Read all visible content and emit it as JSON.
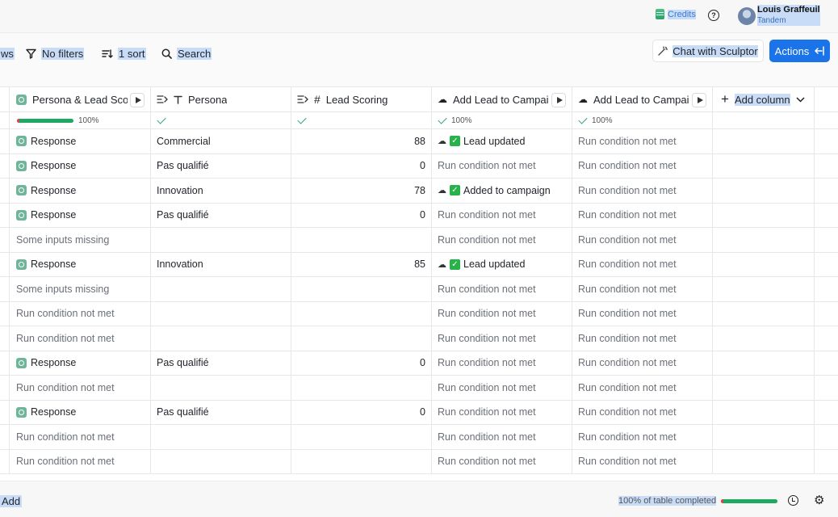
{
  "topbar": {
    "credits_label": "Credits",
    "help_icon": "?",
    "user_name": "Louis Graffeuil",
    "user_org": "Tandem"
  },
  "toolbar": {
    "views_partial": "ws",
    "filters_label": "No filters",
    "sort_label": "1 sort",
    "search_label": "Search",
    "sculptor_label": "Chat with Sculptor",
    "actions_label": "Actions"
  },
  "columns": {
    "c1": "Persona & Lead Scoring",
    "c2": "Persona",
    "c3": "Lead Scoring",
    "c4": "Add Lead to Campaign",
    "c5": "Add Lead to Campaign",
    "add": "Add column"
  },
  "progress": {
    "c1": "100%",
    "c4": "100%",
    "c5": "100%"
  },
  "rows": [
    {
      "c1": "Response",
      "c1_gpt": true,
      "c2": "Commercial",
      "c3": "88",
      "c4": "Lead updated",
      "c4_ok": true,
      "c5": "Run condition not met"
    },
    {
      "c1": "Response",
      "c1_gpt": true,
      "c2": "Pas qualifié",
      "c3": "0",
      "c4": "Run condition not met",
      "c4_ok": false,
      "c5": "Run condition not met"
    },
    {
      "c1": "Response",
      "c1_gpt": true,
      "c2": "Innovation",
      "c3": "78",
      "c4": "Added to campaign",
      "c4_ok": true,
      "c5": "Run condition not met"
    },
    {
      "c1": "Response",
      "c1_gpt": true,
      "c2": "Pas qualifié",
      "c3": "0",
      "c4": "Run condition not met",
      "c4_ok": false,
      "c5": "Run condition not met"
    },
    {
      "c1": "Some inputs missing",
      "c1_gpt": false,
      "c2": "",
      "c3": "",
      "c4": "Run condition not met",
      "c4_ok": false,
      "c5": "Run condition not met"
    },
    {
      "c1": "Response",
      "c1_gpt": true,
      "c2": "Innovation",
      "c3": "85",
      "c4": "Lead updated",
      "c4_ok": true,
      "c5": "Run condition not met"
    },
    {
      "c1": "Some inputs missing",
      "c1_gpt": false,
      "c2": "",
      "c3": "",
      "c4": "Run condition not met",
      "c4_ok": false,
      "c5": "Run condition not met"
    },
    {
      "c1": "Run condition not met",
      "c1_gpt": false,
      "c2": "",
      "c3": "",
      "c4": "Run condition not met",
      "c4_ok": false,
      "c5": "Run condition not met"
    },
    {
      "c1": "Run condition not met",
      "c1_gpt": false,
      "c2": "",
      "c3": "",
      "c4": "Run condition not met",
      "c4_ok": false,
      "c5": "Run condition not met"
    },
    {
      "c1": "Response",
      "c1_gpt": true,
      "c2": "Pas qualifié",
      "c3": "0",
      "c4": "Run condition not met",
      "c4_ok": false,
      "c5": "Run condition not met"
    },
    {
      "c1": "Run condition not met",
      "c1_gpt": false,
      "c2": "",
      "c3": "",
      "c4": "Run condition not met",
      "c4_ok": false,
      "c5": "Run condition not met"
    },
    {
      "c1": "Response",
      "c1_gpt": true,
      "c2": "Pas qualifié",
      "c3": "0",
      "c4": "Run condition not met",
      "c4_ok": false,
      "c5": "Run condition not met"
    },
    {
      "c1": "Run condition not met",
      "c1_gpt": false,
      "c2": "",
      "c3": "",
      "c4": "Run condition not met",
      "c4_ok": false,
      "c5": "Run condition not met"
    },
    {
      "c1": "Run condition not met",
      "c1_gpt": false,
      "c2": "",
      "c3": "",
      "c4": "Run condition not met",
      "c4_ok": false,
      "c5": "Run condition not met"
    }
  ],
  "bottombar": {
    "add_label": "Add",
    "table_progress": "100% of table completed",
    "table_progress_value": 1.0
  },
  "colors": {
    "accent": "#1a73e8",
    "progress_green": "#1fa862",
    "selection_highlight": "#c8dcf7",
    "gpt_icon": "#6fb59a",
    "success_check": "#27b34a"
  }
}
